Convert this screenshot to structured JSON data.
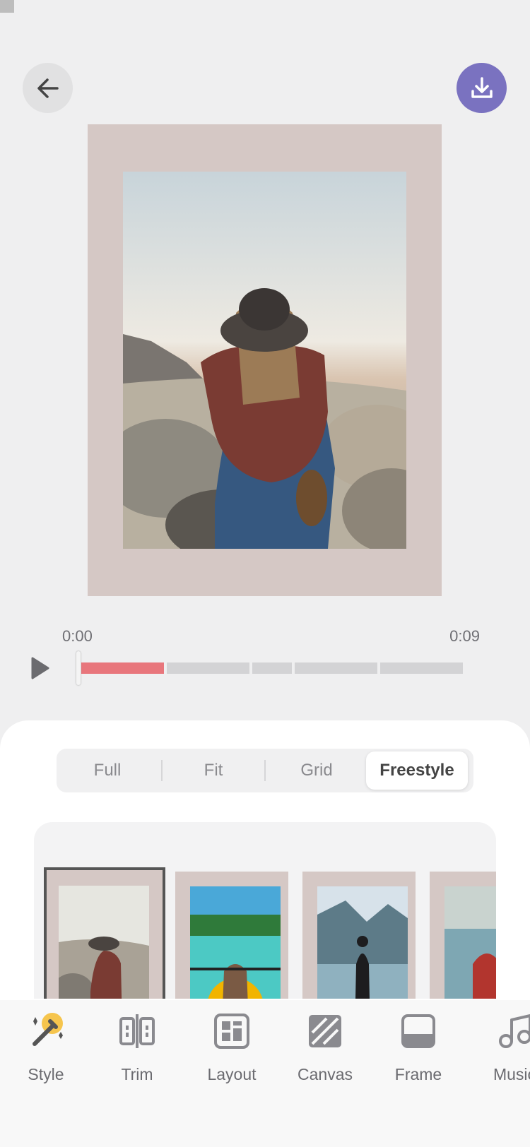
{
  "header": {
    "back_icon": "arrow-left-icon",
    "download_icon": "download-icon",
    "download_color": "#7a72c0"
  },
  "preview": {
    "canvas_color": "#d5c8c5",
    "photo": "woman-in-hat-desert"
  },
  "player": {
    "time_start": "0:00",
    "time_end": "0:09",
    "progress_color": "#e8767c"
  },
  "layout_tabs": [
    "Full",
    "Fit",
    "Grid",
    "Freestyle"
  ],
  "layout_selected": "Freestyle",
  "thumbnails": [
    "woman-in-hat-desert",
    "woman-kayaking",
    "man-at-lake",
    "woman-in-canoe"
  ],
  "toolbar": {
    "items": [
      {
        "label": "Style",
        "icon": "magic-wand-icon"
      },
      {
        "label": "Trim",
        "icon": "trim-icon"
      },
      {
        "label": "Layout",
        "icon": "layout-icon"
      },
      {
        "label": "Canvas",
        "icon": "canvas-icon"
      },
      {
        "label": "Frame",
        "icon": "frame-icon"
      },
      {
        "label": "Music",
        "icon": "music-icon"
      }
    ]
  }
}
